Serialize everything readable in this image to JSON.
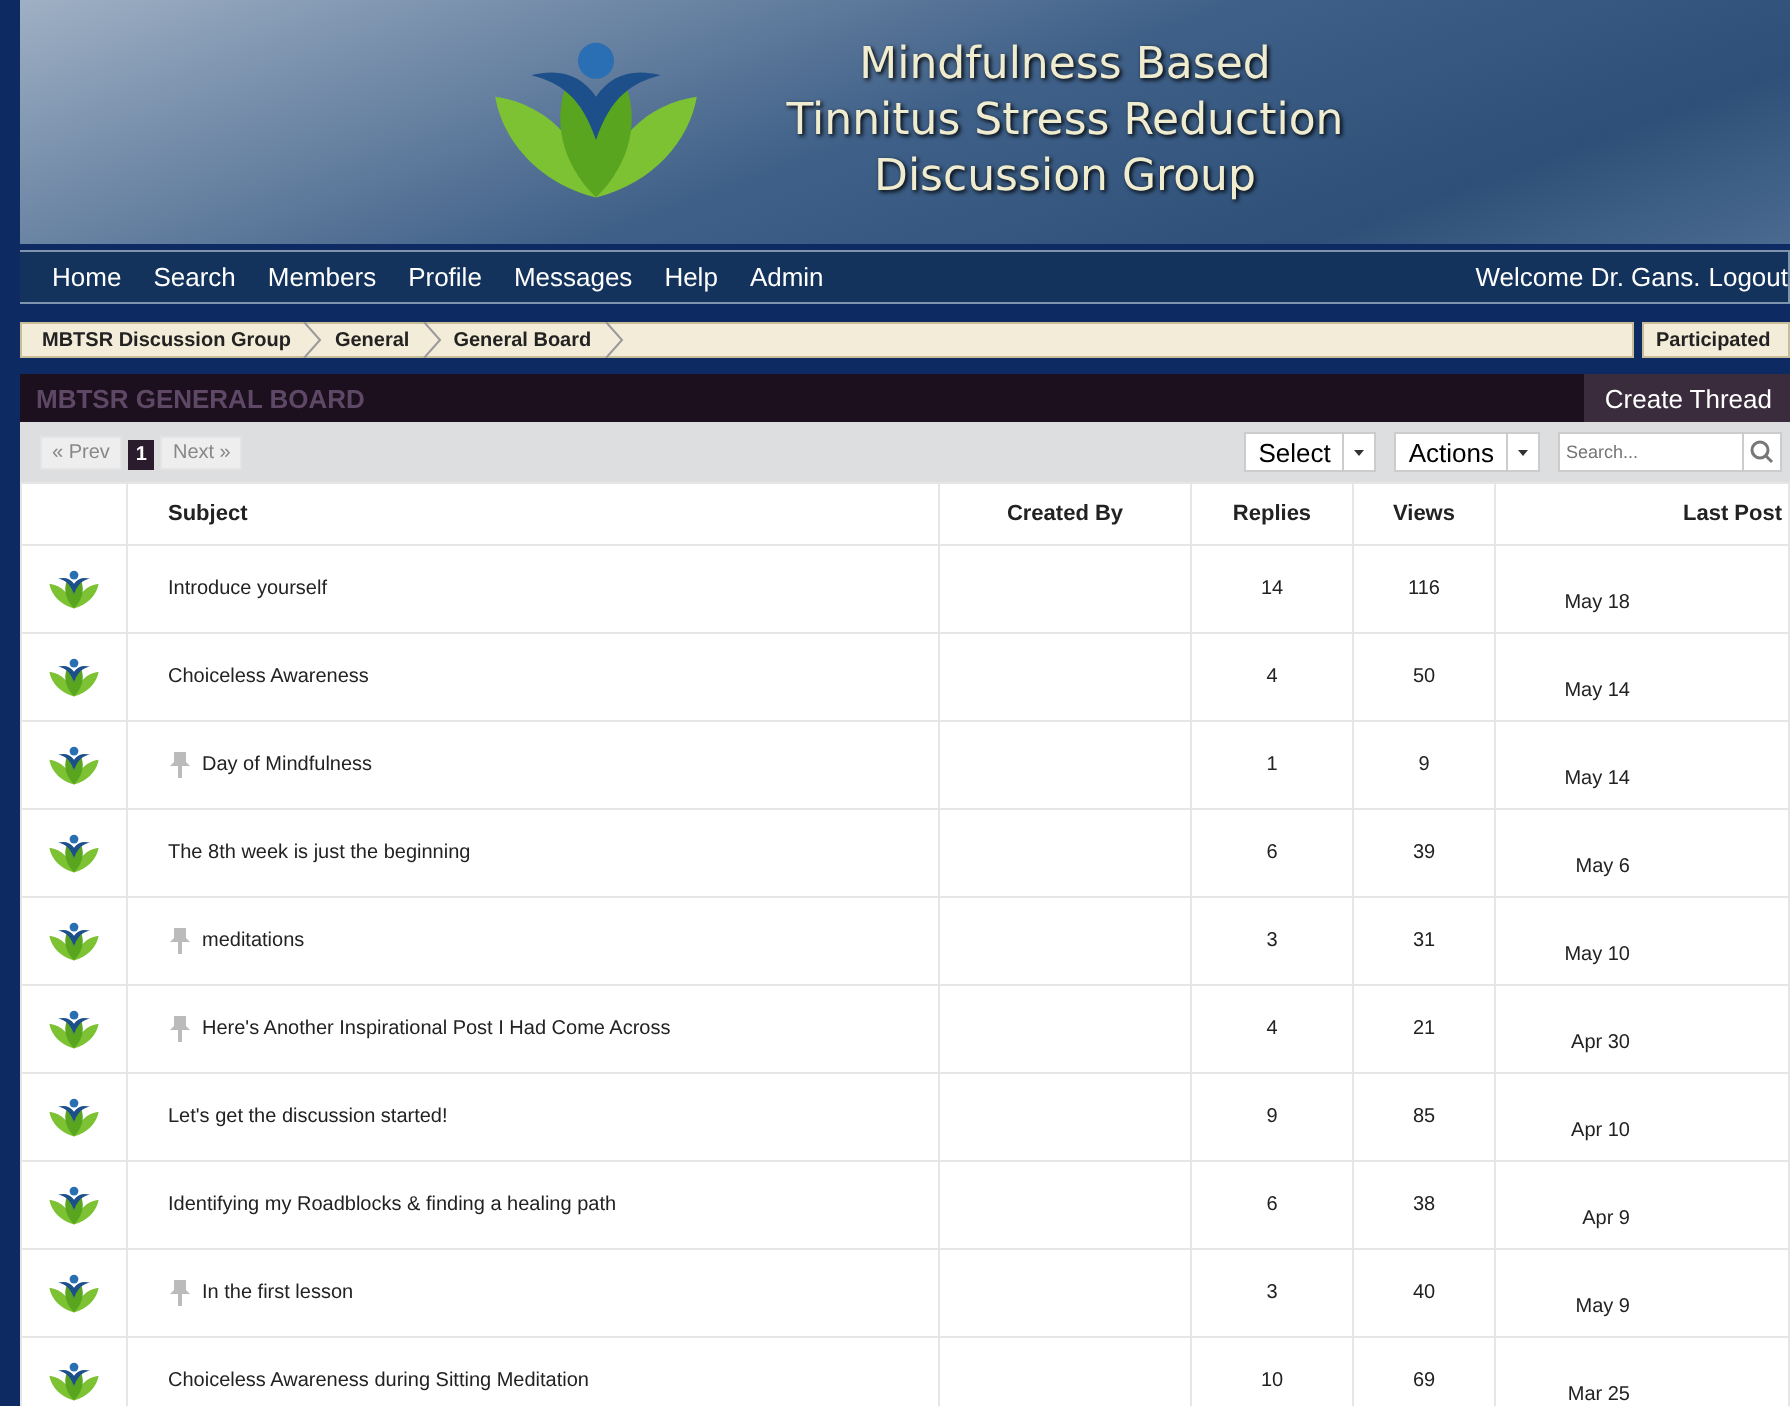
{
  "header": {
    "title_lines": [
      "Mindfulness Based",
      "Tinnitus Stress Reduction",
      "Discussion Group"
    ]
  },
  "nav": {
    "items": [
      "Home",
      "Search",
      "Members",
      "Profile",
      "Messages",
      "Help",
      "Admin"
    ],
    "welcome": "Welcome Dr. Gans.",
    "logout": "Logout"
  },
  "breadcrumb": {
    "items": [
      "MBTSR Discussion Group",
      "General",
      "General Board"
    ],
    "filter": "Participated"
  },
  "board": {
    "title": "MBTSR GENERAL BOARD",
    "create_button": "Create Thread"
  },
  "toolbar": {
    "prev": "« Prev",
    "pages": [
      {
        "label": "1",
        "selected": true
      }
    ],
    "next": "Next »",
    "select": "Select",
    "actions": "Actions",
    "search": {
      "placeholder": "Search..."
    }
  },
  "table": {
    "columns": [
      "Subject",
      "Created By",
      "Replies",
      "Views",
      "Last Post"
    ],
    "rows": [
      {
        "subject": "Introduce yourself",
        "pinned": false,
        "replies": "14",
        "views": "116",
        "last_post": "May 18"
      },
      {
        "subject": "Choiceless Awareness",
        "pinned": false,
        "replies": "4",
        "views": "50",
        "last_post": "May 14"
      },
      {
        "subject": "Day of Mindfulness",
        "pinned": true,
        "replies": "1",
        "views": "9",
        "last_post": "May 14"
      },
      {
        "subject": "The 8th week is just the beginning",
        "pinned": false,
        "replies": "6",
        "views": "39",
        "last_post": "May 6"
      },
      {
        "subject": "meditations",
        "pinned": true,
        "replies": "3",
        "views": "31",
        "last_post": "May 10"
      },
      {
        "subject": "Here's Another Inspirational Post I Had Come Across",
        "pinned": true,
        "replies": "4",
        "views": "21",
        "last_post": "Apr 30"
      },
      {
        "subject": "Let's get the discussion started!",
        "pinned": false,
        "replies": "9",
        "views": "85",
        "last_post": "Apr 10"
      },
      {
        "subject": "Identifying my Roadblocks & finding a healing path",
        "pinned": false,
        "replies": "6",
        "views": "38",
        "last_post": "Apr 9"
      },
      {
        "subject": "In the first lesson",
        "pinned": true,
        "replies": "3",
        "views": "40",
        "last_post": "May 9"
      },
      {
        "subject": "Choiceless Awareness during Sitting Meditation",
        "pinned": false,
        "replies": "10",
        "views": "69",
        "last_post": "Mar 25"
      }
    ]
  }
}
